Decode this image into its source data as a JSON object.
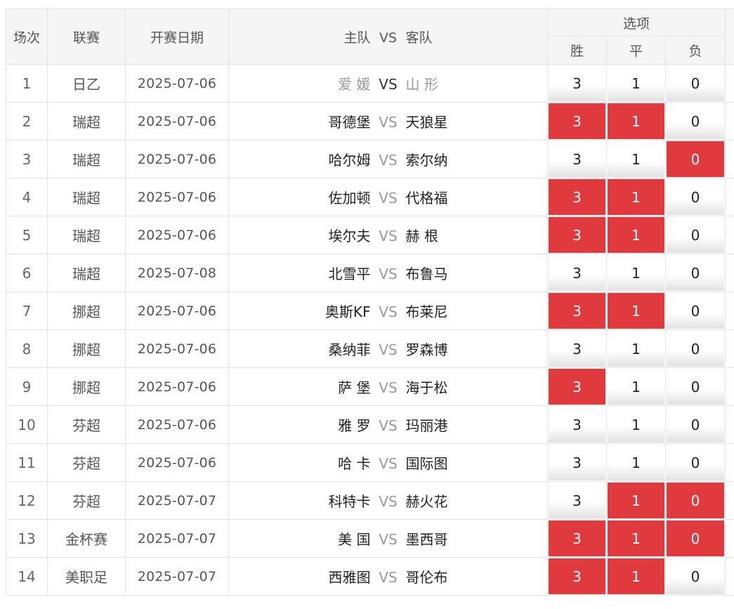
{
  "headers": {
    "round": "场次",
    "league": "联赛",
    "date": "开赛日期",
    "home": "主队",
    "vs": "VS",
    "away": "客队",
    "options": "选项",
    "win": "胜",
    "draw": "平",
    "lose": "负"
  },
  "colors": {
    "selected": "#e0393e",
    "header_bg": "#f5f5f5",
    "border": "#e3e3e3"
  },
  "rows": [
    {
      "no": "1",
      "league": "日乙",
      "date": "2025-07-06",
      "home": "爱 媛",
      "vs": "VS",
      "away": "山 形",
      "win": "3",
      "draw": "1",
      "lose": "0",
      "sel": [
        false,
        false,
        false
      ],
      "dim": true
    },
    {
      "no": "2",
      "league": "瑞超",
      "date": "2025-07-06",
      "home": "哥德堡",
      "vs": "VS",
      "away": "天狼星",
      "win": "3",
      "draw": "1",
      "lose": "0",
      "sel": [
        true,
        true,
        false
      ]
    },
    {
      "no": "3",
      "league": "瑞超",
      "date": "2025-07-06",
      "home": "哈尔姆",
      "vs": "VS",
      "away": "索尔纳",
      "win": "3",
      "draw": "1",
      "lose": "0",
      "sel": [
        false,
        false,
        true
      ]
    },
    {
      "no": "4",
      "league": "瑞超",
      "date": "2025-07-06",
      "home": "佐加顿",
      "vs": "VS",
      "away": "代格福",
      "win": "3",
      "draw": "1",
      "lose": "0",
      "sel": [
        true,
        true,
        false
      ]
    },
    {
      "no": "5",
      "league": "瑞超",
      "date": "2025-07-06",
      "home": "埃尔夫",
      "vs": "VS",
      "away": "赫 根",
      "win": "3",
      "draw": "1",
      "lose": "0",
      "sel": [
        true,
        true,
        false
      ]
    },
    {
      "no": "6",
      "league": "瑞超",
      "date": "2025-07-08",
      "home": "北雪平",
      "vs": "VS",
      "away": "布鲁马",
      "win": "3",
      "draw": "1",
      "lose": "0",
      "sel": [
        false,
        false,
        false
      ]
    },
    {
      "no": "7",
      "league": "挪超",
      "date": "2025-07-06",
      "home": "奥斯KF",
      "vs": "VS",
      "away": "布莱尼",
      "win": "3",
      "draw": "1",
      "lose": "0",
      "sel": [
        true,
        true,
        false
      ]
    },
    {
      "no": "8",
      "league": "挪超",
      "date": "2025-07-06",
      "home": "桑纳菲",
      "vs": "VS",
      "away": "罗森博",
      "win": "3",
      "draw": "1",
      "lose": "0",
      "sel": [
        false,
        false,
        false
      ]
    },
    {
      "no": "9",
      "league": "挪超",
      "date": "2025-07-06",
      "home": "萨 堡",
      "vs": "VS",
      "away": "海于松",
      "win": "3",
      "draw": "1",
      "lose": "0",
      "sel": [
        true,
        false,
        false
      ]
    },
    {
      "no": "10",
      "league": "芬超",
      "date": "2025-07-06",
      "home": "雅 罗",
      "vs": "VS",
      "away": "玛丽港",
      "win": "3",
      "draw": "1",
      "lose": "0",
      "sel": [
        false,
        false,
        false
      ]
    },
    {
      "no": "11",
      "league": "芬超",
      "date": "2025-07-06",
      "home": "哈 卡",
      "vs": "VS",
      "away": "国际图",
      "win": "3",
      "draw": "1",
      "lose": "0",
      "sel": [
        false,
        false,
        false
      ]
    },
    {
      "no": "12",
      "league": "芬超",
      "date": "2025-07-07",
      "home": "科特卡",
      "vs": "VS",
      "away": "赫火花",
      "win": "3",
      "draw": "1",
      "lose": "0",
      "sel": [
        false,
        true,
        true
      ]
    },
    {
      "no": "13",
      "league": "金杯赛",
      "date": "2025-07-07",
      "home": "美 国",
      "vs": "VS",
      "away": "墨西哥",
      "win": "3",
      "draw": "1",
      "lose": "0",
      "sel": [
        true,
        true,
        true
      ]
    },
    {
      "no": "14",
      "league": "美职足",
      "date": "2025-07-07",
      "home": "西雅图",
      "vs": "VS",
      "away": "哥伦布",
      "win": "3",
      "draw": "1",
      "lose": "0",
      "sel": [
        true,
        true,
        false
      ]
    }
  ]
}
